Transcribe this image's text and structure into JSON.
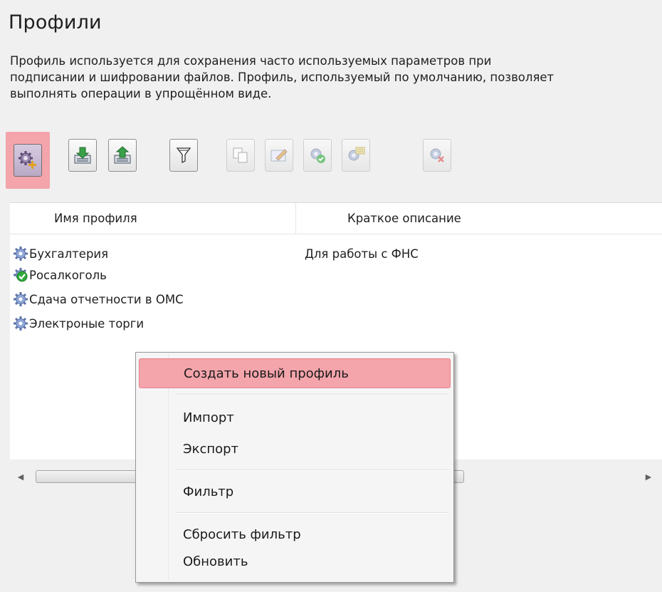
{
  "page": {
    "title": "Профили",
    "description_lines": [
      "Профиль используется для сохранения часто используемых параметров при",
      "подписании и шифровании файлов. Профиль, используемый по умолчанию, позволяет",
      "выполнять операции в упрощённом виде."
    ]
  },
  "toolbar": {
    "buttons": [
      {
        "icon": "create-profile-icon",
        "state": "highlighted"
      },
      {
        "icon": "import-icon",
        "state": "enabled"
      },
      {
        "icon": "export-icon",
        "state": "enabled"
      },
      {
        "icon": "filter-icon",
        "state": "enabled"
      },
      {
        "icon": "copy-icon",
        "state": "disabled"
      },
      {
        "icon": "edit-icon",
        "state": "disabled"
      },
      {
        "icon": "set-default-icon",
        "state": "disabled"
      },
      {
        "icon": "properties-icon",
        "state": "disabled"
      },
      {
        "icon": "delete-profile-icon",
        "state": "disabled"
      }
    ]
  },
  "table": {
    "columns": [
      "Имя профиля",
      "Краткое описание"
    ],
    "rows": [
      {
        "name": "Бухгалтерия",
        "description": "Для работы с ФНС",
        "icon": "gear-icon"
      },
      {
        "name": "Росалкоголь",
        "description": "",
        "icon": "gear-default-check-icon"
      },
      {
        "name": "Сдача отчетности в ОМС",
        "description": "",
        "icon": "gear-icon"
      },
      {
        "name": "Электроные торги",
        "description": "",
        "icon": "gear-icon"
      }
    ]
  },
  "context_menu": {
    "items": [
      "Создать новый профиль",
      "Импорт",
      "Экспорт",
      "Фильтр",
      "Сбросить фильтр",
      "Обновить"
    ],
    "highlighted": "Создать новый профиль"
  },
  "colors": {
    "highlight": "#f4a4ab",
    "background": "#f0f0f0",
    "gear": "#8fa6d6",
    "check": "#2faa3c"
  }
}
